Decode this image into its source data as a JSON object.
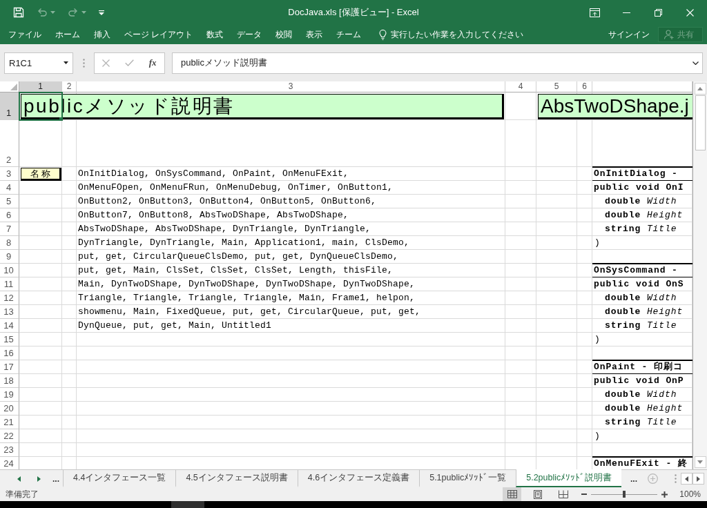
{
  "window": {
    "title": "DocJava.xls [保護ビュー] - Excel"
  },
  "quick_access": [
    {
      "kind": "save",
      "disabled": false
    },
    {
      "kind": "undo",
      "disabled": true
    },
    {
      "kind": "redo",
      "disabled": true
    },
    {
      "kind": "customize",
      "disabled": false
    }
  ],
  "ribbon": {
    "tabs": [
      {
        "label": "ファイル",
        "selected": false
      },
      {
        "label": "ホーム",
        "selected": false
      },
      {
        "label": "挿入",
        "selected": false
      },
      {
        "label": "ページ レイアウト",
        "selected": false
      },
      {
        "label": "数式",
        "selected": false
      },
      {
        "label": "データ",
        "selected": false
      },
      {
        "label": "校閲",
        "selected": false
      },
      {
        "label": "表示",
        "selected": false
      },
      {
        "label": "チーム",
        "selected": false
      }
    ],
    "tell_me": "実行したい作業を入力してください",
    "sign_in": "サインイン",
    "share": {
      "label": "共有",
      "disabled": true
    }
  },
  "formula_bar": {
    "name_box": "R1C1",
    "buttons": [
      {
        "kind": "cancel",
        "disabled": true
      },
      {
        "kind": "enter",
        "disabled": true
      },
      {
        "kind": "function",
        "label": "fx",
        "disabled": false
      }
    ],
    "formula": "publicメソッド説明書"
  },
  "sheet": {
    "columns": [
      {
        "label": "1",
        "selected": true
      },
      {
        "label": "2",
        "selected": false
      },
      {
        "label": "3",
        "selected": false
      },
      {
        "label": "4",
        "selected": false
      },
      {
        "label": "5",
        "selected": false
      },
      {
        "label": "6",
        "selected": false
      }
    ],
    "rows": [
      {
        "label": "1",
        "selected": true
      },
      {
        "label": "2",
        "selected": false
      },
      {
        "label": "3",
        "selected": false
      },
      {
        "label": "4",
        "selected": false
      },
      {
        "label": "5",
        "selected": false
      },
      {
        "label": "6",
        "selected": false
      },
      {
        "label": "7",
        "selected": false
      },
      {
        "label": "8",
        "selected": false
      },
      {
        "label": "9",
        "selected": false
      },
      {
        "label": "10",
        "selected": false
      },
      {
        "label": "11",
        "selected": false
      },
      {
        "label": "12",
        "selected": false
      },
      {
        "label": "13",
        "selected": false
      },
      {
        "label": "14",
        "selected": false
      },
      {
        "label": "15",
        "selected": false
      },
      {
        "label": "16",
        "selected": false
      },
      {
        "label": "17",
        "selected": false
      },
      {
        "label": "18",
        "selected": false
      },
      {
        "label": "19",
        "selected": false
      },
      {
        "label": "20",
        "selected": false
      },
      {
        "label": "21",
        "selected": false
      },
      {
        "label": "22",
        "selected": false
      },
      {
        "label": "23",
        "selected": false
      },
      {
        "label": "24",
        "selected": false
      }
    ],
    "titles": [
      "publicメソッド説明書",
      "AbsTwoDShape.j"
    ],
    "name_label": "名 称",
    "name_list": [
      "OnInitDialog, OnSysCommand, OnPaint, OnMenuFExit,",
      "OnMenuFOpen, OnMenuFRun, OnMenuDebug, OnTimer, OnButton1,",
      "OnButton2, OnButton3, OnButton4, OnButton5, OnButton6,",
      "OnButton7, OnButton8, AbsTwoDShape, AbsTwoDShape,",
      "AbsTwoDShape, AbsTwoDShape, DynTriangle, DynTriangle,",
      "DynTriangle, DynTriangle, Main, Application1, main, ClsDemo,",
      "put, get, CircularQueueClsDemo, put, get, DynQueueClsDemo,",
      "put, get, Main, ClsSet, ClsSet, ClsSet, Length, thisFile,",
      "Main, DynTwoDShape, DynTwoDShape, DynTwoDShape, DynTwoDShape,",
      "Triangle, Triangle, Triangle, Triangle, Main, Frame1, helpon,",
      "showmenu, Main, FixedQueue, put, get, CircularQueue, put, get,",
      "DynQueue, put, get, Main, Untitled1"
    ],
    "methods": [
      {
        "heading": "OnInitDialog -",
        "signature": "public void OnI",
        "params": [
          "double *Width*",
          "double *Height*",
          "string *Title*"
        ],
        "close": ")"
      },
      {
        "heading": "OnSysCommand -",
        "signature": "public void OnS",
        "params": [
          "double *Width*",
          "double *Height*",
          "string *Title*"
        ],
        "close": ")"
      },
      {
        "heading": "OnPaint - 印刷コ",
        "signature": "public void OnP",
        "params": [
          "double *Width*",
          "double *Height*",
          "string *Title*"
        ],
        "close": ")"
      },
      {
        "heading": "OnMenuFExit - 終"
      }
    ]
  },
  "sheet_tabs": {
    "more_left": "...",
    "tabs": [
      {
        "label": "4.4インタフェース一覧",
        "selected": false
      },
      {
        "label": "4.5インタフェース説明書",
        "selected": false
      },
      {
        "label": "4.6インタフェース定義書",
        "selected": false
      },
      {
        "label": "5.1publicﾒｿｯﾄﾞ一覧",
        "selected": false
      },
      {
        "label": "5.2publicﾒｿｯﾄﾞ説明書",
        "selected": true
      }
    ],
    "more_right": "..."
  },
  "status_bar": {
    "text": "準備完了",
    "views": [
      {
        "kind": "normal",
        "selected": true
      },
      {
        "kind": "page_layout",
        "selected": false
      },
      {
        "kind": "page_break",
        "selected": false
      }
    ],
    "zoom": {
      "level": 0.5,
      "reading": "100%"
    }
  }
}
